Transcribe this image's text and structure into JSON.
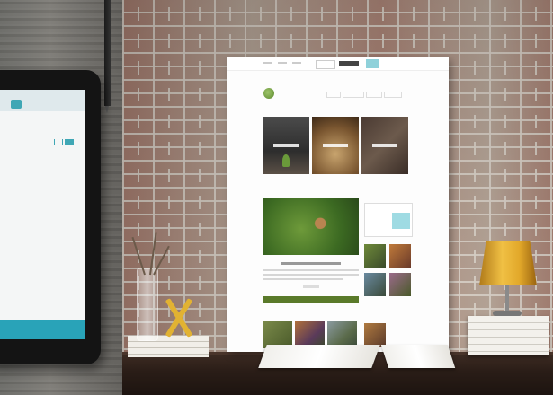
{
  "colors": {
    "accent_teal": "#29a3b8",
    "site_green": "#5a7a2a",
    "lamp_gold": "#f0c044"
  },
  "tablet": {
    "icons": [
      "menu-button-icon",
      "cart-icon"
    ]
  },
  "website_print": {
    "icons": [
      "logo-icon"
    ]
  }
}
